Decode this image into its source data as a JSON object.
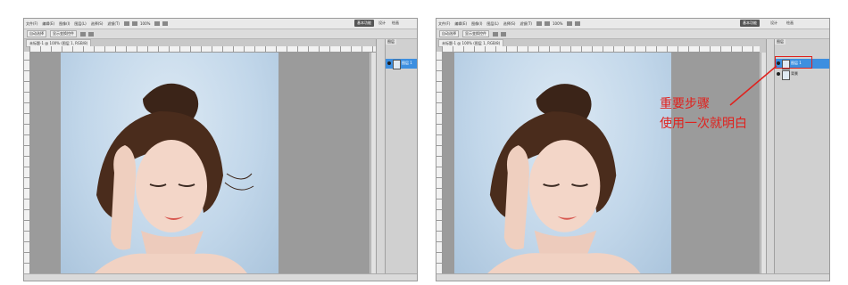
{
  "menubar": {
    "items": [
      "文件(F)",
      "编辑(E)",
      "图像(I)",
      "图层(L)",
      "选择(S)",
      "滤镜(T)",
      "分析(A)",
      "3D(D)",
      "视图(V)",
      "窗口(W)",
      "帮助(H)"
    ],
    "zoom": "100%"
  },
  "workspace": {
    "essentials_label": "基本功能",
    "design_label": "设计",
    "paint_label": "绘画"
  },
  "optbar": {
    "items": [
      "自动选择",
      "显示变换控件"
    ]
  },
  "document": {
    "tab_label": "未标题-1 @ 100% (图层 1, RGB/8)"
  },
  "layers_panel": {
    "tab_label": "图层",
    "layers": [
      "图层 1",
      "背景"
    ]
  },
  "annotation": {
    "line1": "重要步骤",
    "line2": "使用一次就明白",
    "color": "#e0211d"
  },
  "colors": {
    "selection": "#3d8fe0",
    "canvas_bg": "#9b9b9b"
  }
}
